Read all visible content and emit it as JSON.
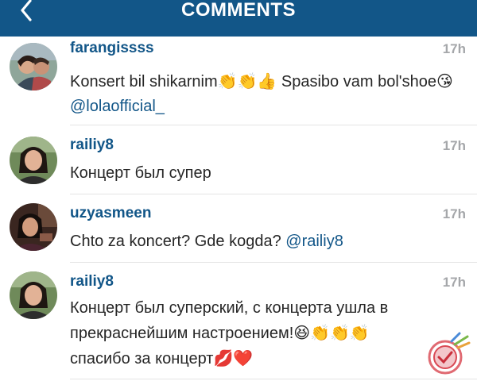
{
  "header": {
    "title": "COMMENTS",
    "back_icon": "chevron-left-icon"
  },
  "colors": {
    "header_bg": "#125688",
    "username": "#125688",
    "mention": "#125688",
    "timestamp": "#a5a7aa",
    "text": "#262626",
    "divider": "#e4e4e4"
  },
  "comments": [
    {
      "username": "farangissss",
      "time": "17h",
      "text_before": "Konsert bil shikarnim",
      "emoji_1": "👏👏👍",
      "text_middle": " Spasibo vam bol'shoe",
      "emoji_2": "😘",
      "mention": "@lolaofficial_"
    },
    {
      "username": "railiy8",
      "time": "17h",
      "text": "Концерт был супер"
    },
    {
      "username": "uzyasmeen",
      "time": "17h",
      "text_before": "Chto za koncert? Gde kogda? ",
      "mention": "@railiy8"
    },
    {
      "username": "railiy8",
      "time": "17h",
      "text_before": "Концерт был суперский, с концерта ушла  в прекраснейшим настроением!",
      "emoji_1": "😆👏👏👏",
      "text_after": "спасибо за концерт",
      "emoji_2": "💋❤️"
    }
  ]
}
